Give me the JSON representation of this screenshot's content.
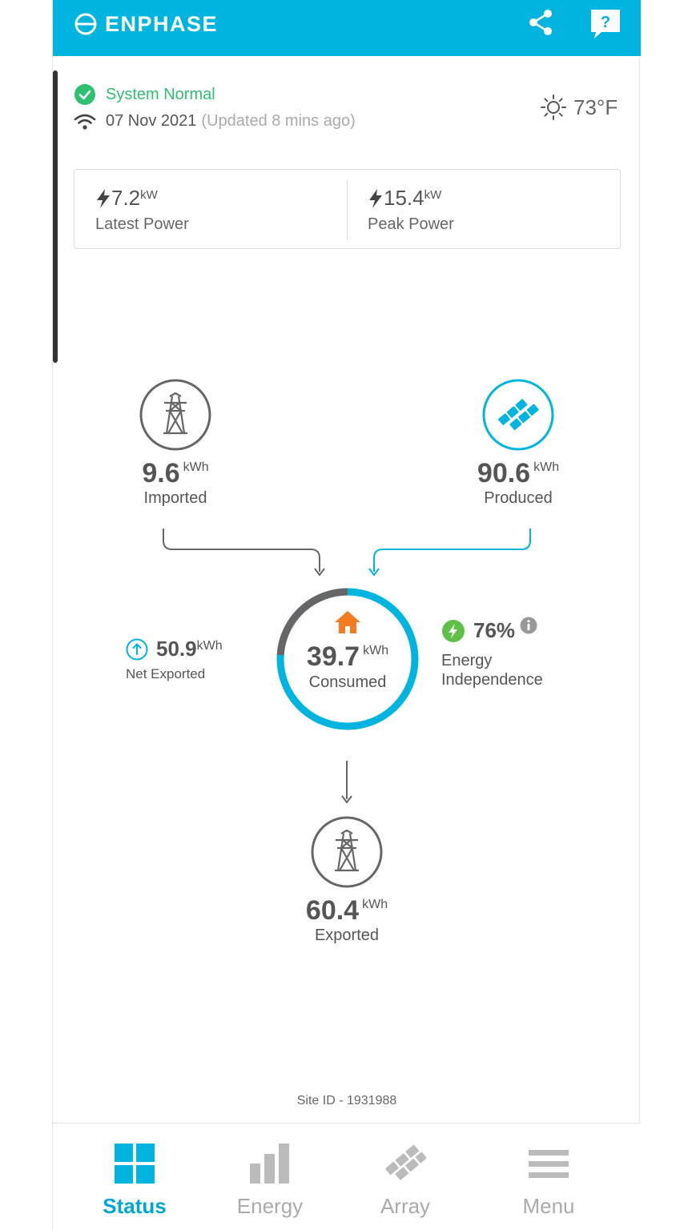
{
  "header": {
    "brand": "ENPHASE",
    "brand_color": "#00b4e0",
    "share_icon": "share-icon",
    "help_icon": "help-icon",
    "help_glyph": "?"
  },
  "status": {
    "text": "System Normal",
    "date": "07 Nov 2021",
    "updated": "(Updated 8 mins ago)",
    "temperature": "73°F"
  },
  "power": {
    "latest_value": "7.2",
    "latest_unit": "kW",
    "latest_label": "Latest Power",
    "peak_value": "15.4",
    "peak_unit": "kW",
    "peak_label": "Peak Power"
  },
  "flow": {
    "imported": {
      "value": "9.6",
      "unit": "kWh",
      "label": "Imported"
    },
    "produced": {
      "value": "90.6",
      "unit": "kWh",
      "label": "Produced"
    },
    "consumed": {
      "value": "39.7",
      "unit": "kWh",
      "label": "Consumed",
      "grid_fraction": 0.24
    },
    "exported": {
      "value": "60.4",
      "unit": "kWh",
      "label": "Exported"
    },
    "net_exported": {
      "value": "50.9",
      "unit": "kWh",
      "label": "Net Exported"
    },
    "independence": {
      "value": "76%",
      "label": "Energy Independence"
    }
  },
  "colors": {
    "accent": "#00b4e0",
    "status_green": "#2fbf71",
    "home_orange": "#f47b20",
    "grid_gray": "#666666"
  },
  "site_id": "Site ID - 1931988",
  "nav": {
    "tabs": [
      {
        "label": "Status",
        "icon": "grid-icon",
        "active": true
      },
      {
        "label": "Energy",
        "icon": "bar-chart-icon",
        "active": false
      },
      {
        "label": "Array",
        "icon": "solar-array-icon",
        "active": false
      },
      {
        "label": "Menu",
        "icon": "hamburger-icon",
        "active": false
      }
    ]
  }
}
